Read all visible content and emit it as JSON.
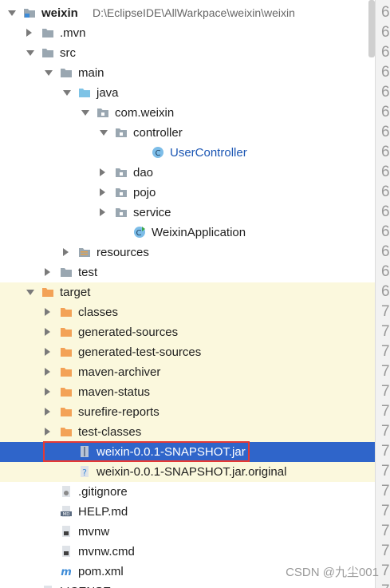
{
  "project": {
    "name": "weixin",
    "path": "D:\\EclipseIDE\\AllWarkpace\\weixin\\weixin"
  },
  "tree": [
    {
      "label": "weixin",
      "arrow": "down",
      "icon": "project-module-icon",
      "depth": 0,
      "bold": true
    },
    {
      "label": ".mvn",
      "arrow": "right",
      "icon": "folder-gray-icon",
      "depth": 1
    },
    {
      "label": "src",
      "arrow": "down",
      "icon": "folder-gray-icon",
      "depth": 1
    },
    {
      "label": "main",
      "arrow": "down",
      "icon": "folder-gray-icon",
      "depth": 2
    },
    {
      "label": "java",
      "arrow": "down",
      "icon": "folder-source-blue-icon",
      "depth": 3
    },
    {
      "label": "com.weixin",
      "arrow": "down",
      "icon": "package-icon",
      "depth": 4
    },
    {
      "label": "controller",
      "arrow": "down",
      "icon": "package-icon",
      "depth": 5
    },
    {
      "label": "UserController",
      "arrow": "",
      "icon": "java-class-icon",
      "depth": 7,
      "blue": true
    },
    {
      "label": "dao",
      "arrow": "right",
      "icon": "package-icon",
      "depth": 5
    },
    {
      "label": "pojo",
      "arrow": "right",
      "icon": "package-icon",
      "depth": 5
    },
    {
      "label": "service",
      "arrow": "right",
      "icon": "package-icon",
      "depth": 5
    },
    {
      "label": "WeixinApplication",
      "arrow": "",
      "icon": "spring-boot-class-icon",
      "depth": 6
    },
    {
      "label": "resources",
      "arrow": "right",
      "icon": "resources-folder-icon",
      "depth": 3
    },
    {
      "label": "test",
      "arrow": "right",
      "icon": "folder-gray-icon",
      "depth": 2
    },
    {
      "label": "target",
      "arrow": "down",
      "icon": "folder-orange-icon",
      "depth": 1,
      "yellow": true
    },
    {
      "label": "classes",
      "arrow": "right",
      "icon": "folder-orange-icon",
      "depth": 2,
      "yellow": true
    },
    {
      "label": "generated-sources",
      "arrow": "right",
      "icon": "folder-orange-icon",
      "depth": 2,
      "yellow": true
    },
    {
      "label": "generated-test-sources",
      "arrow": "right",
      "icon": "folder-orange-icon",
      "depth": 2,
      "yellow": true
    },
    {
      "label": "maven-archiver",
      "arrow": "right",
      "icon": "folder-orange-icon",
      "depth": 2,
      "yellow": true
    },
    {
      "label": "maven-status",
      "arrow": "right",
      "icon": "folder-orange-icon",
      "depth": 2,
      "yellow": true
    },
    {
      "label": "surefire-reports",
      "arrow": "right",
      "icon": "folder-orange-icon",
      "depth": 2,
      "yellow": true
    },
    {
      "label": "test-classes",
      "arrow": "right",
      "icon": "folder-orange-icon",
      "depth": 2,
      "yellow": true
    },
    {
      "label": "weixin-0.0.1-SNAPSHOT.jar",
      "arrow": "",
      "icon": "jar-archive-icon",
      "depth": 3,
      "selected": true
    },
    {
      "label": "weixin-0.0.1-SNAPSHOT.jar.original",
      "arrow": "",
      "icon": "unknown-file-icon",
      "depth": 3,
      "yellow": true
    },
    {
      "label": ".gitignore",
      "arrow": "",
      "icon": "gitignore-file-icon",
      "depth": 2
    },
    {
      "label": "HELP.md",
      "arrow": "",
      "icon": "markdown-file-icon",
      "depth": 2
    },
    {
      "label": "mvnw",
      "arrow": "",
      "icon": "script-file-icon",
      "depth": 2
    },
    {
      "label": "mvnw.cmd",
      "arrow": "",
      "icon": "script-file-icon",
      "depth": 2
    },
    {
      "label": "pom.xml",
      "arrow": "",
      "icon": "maven-pom-icon",
      "depth": 2
    },
    {
      "label": "LICENSE",
      "arrow": "",
      "icon": "text-file-icon",
      "depth": 1
    }
  ],
  "gutter_numbers": [
    "6",
    "6",
    "6",
    "6",
    "6",
    "6",
    "6",
    "6",
    "6",
    "6",
    "6",
    "6",
    "6",
    "6",
    "6",
    "7",
    "7",
    "7",
    "7",
    "7",
    "7",
    "7",
    "7",
    "7",
    "7",
    "7",
    "7",
    "7",
    "7",
    "7"
  ],
  "watermark": "CSDN @九尘001",
  "colors": {
    "selected": "#2f65ca",
    "excluded_bg": "#fbf8dd",
    "highlight": "#e53935",
    "class_blue": "#1a55b3"
  }
}
